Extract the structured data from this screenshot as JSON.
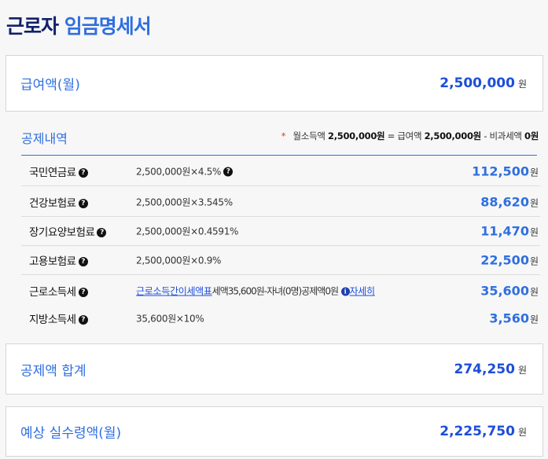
{
  "title": {
    "part1": "근로자",
    "part2": "임금명세서"
  },
  "pay": {
    "label": "급여액(월)",
    "value": "2,500,000",
    "unit": "원"
  },
  "deductions": {
    "heading": "공제내역",
    "summary": {
      "star": "*",
      "monthly_income_label": "월소득액",
      "monthly_income_value": "2,500,000원",
      "eq": "=",
      "pay_label": "급여액",
      "pay_value": "2,500,000원",
      "minus": "-",
      "nontax_label": "비과세액",
      "nontax_value": "0원"
    },
    "items": [
      {
        "name": "국민연금료",
        "formula": "2,500,000원×4.5%",
        "value": "112,500",
        "unit": "원"
      },
      {
        "name": "건강보험료",
        "formula": "2,500,000원×3.545%",
        "value": "88,620",
        "unit": "원"
      },
      {
        "name": "장기요양보험료",
        "formula": "2,500,000원×0.4591%",
        "value": "11,470",
        "unit": "원"
      },
      {
        "name": "고용보험료",
        "formula": "2,500,000원×0.9%",
        "value": "22,500",
        "unit": "원"
      },
      {
        "name": "근로소득세",
        "link": "근로소득간이세액표",
        "formula_rest": "세액35,600원-자녀(0명)공제액0원",
        "detail_link": "자세히",
        "value": "35,600",
        "unit": "원"
      },
      {
        "name": "지방소득세",
        "formula": "35,600원×10%",
        "value": "3,560",
        "unit": "원"
      }
    ]
  },
  "total": {
    "label": "공제액 합계",
    "value": "274,250",
    "unit": "원"
  },
  "net": {
    "label": "예상 실수령액(월)",
    "value": "2,225,750",
    "unit": "원"
  },
  "icons": {
    "question": "?",
    "info": "i"
  },
  "colors": {
    "accent": "#2f6fe0",
    "dark_blue": "#13206b",
    "value_blue": "#1d4ed8",
    "star_red": "#d33333"
  }
}
